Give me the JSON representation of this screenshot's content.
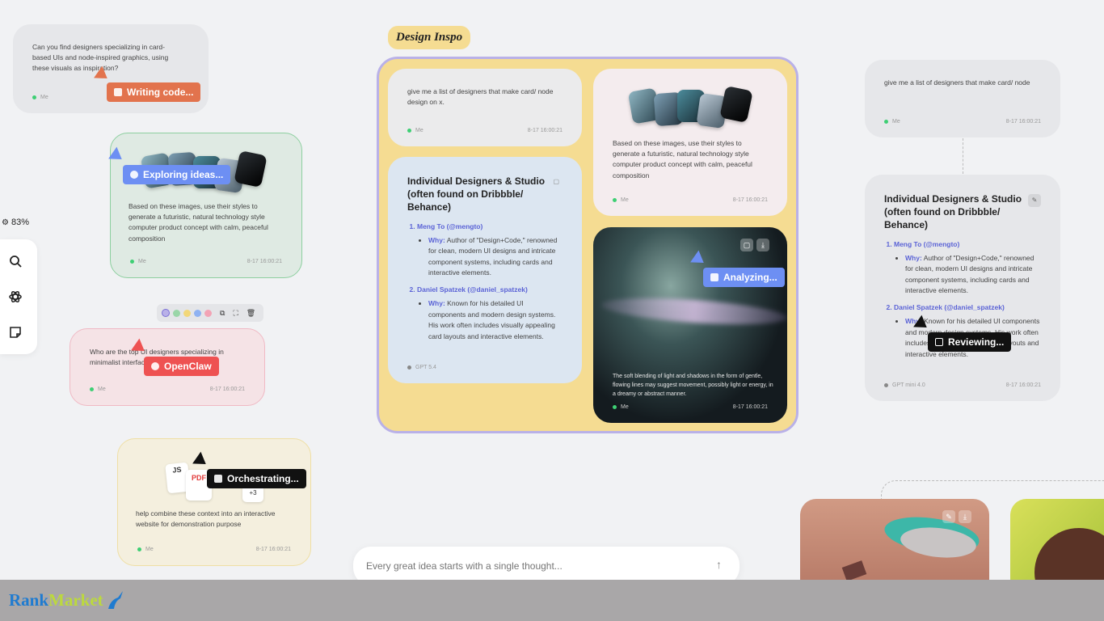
{
  "zoom": "83%",
  "cards": {
    "c1": {
      "text": "Can you find designers specializing in card-based UIs and node-inspired graphics, using these visuals as inspiration?",
      "who": "Me"
    },
    "c2": {
      "text": "Based on these images, use their styles to generate a futuristic, natural technology style computer product concept with calm, peaceful composition",
      "who": "Me",
      "time": "8-17 16:00:21"
    },
    "c3": {
      "text": "Who are the top UI designers specializing in minimalist interfaces?",
      "who": "Me",
      "time": "8-17 16:00:21"
    },
    "c4": {
      "text": "help combine these context into an interactive website for demonstration purpose",
      "who": "Me",
      "time": "8-17 16:00:21",
      "file_js": "JS",
      "file_pdf": "PDF",
      "more": "+3"
    },
    "g1": {
      "text": "give me a list of designers that make card/ node design on x.",
      "who": "Me",
      "time": "8-17 16:00:21"
    },
    "g2": {
      "text": "Based on these images, use their styles to generate a futuristic, natural technology style computer product concept with calm, peaceful composition",
      "who": "Me",
      "time": "8-17 16:00:21"
    },
    "g3": {
      "title": "Individual Designers & Studio (often found on Dribbble/ Behance)",
      "d1_name": "Meng To (@mengto)",
      "d1_why": "Why:",
      "d1_desc": "Author of \"Design+Code,\" renowned for clean, modern UI designs and intricate component systems, including cards and interactive elements.",
      "d2_name": "Daniel Spatzek (@daniel_spatzek)",
      "d2_why": "Why:",
      "d2_desc": "Known for his detailed UI components and modern design systems. His work often includes visually appealing card layouts and interactive elements.",
      "model": "GPT 5.4"
    },
    "g4": {
      "text": "The soft blending of light and shadows in the form of gentle, flowing lines may suggest movement, possibly light or energy, in a dreamy or abstract manner.",
      "who": "Me",
      "time": "8-17 16:00:21"
    },
    "r1": {
      "text": "give me a list of designers that make card/ node",
      "who": "Me",
      "time": "8-17 16:00:21"
    },
    "r2": {
      "title": "Individual Designers & Studio (often found on Dribbble/ Behance)",
      "d1_name": "Meng To (@mengto)",
      "d1_why": "Why:",
      "d1_desc": "Author of \"Design+Code,\" renowned for clean, modern UI designs and intricate component systems, including cards and interactive elements.",
      "d2_name": "Daniel Spatzek (@daniel_spatzek)",
      "d2_why": "Why:",
      "d2_desc": "Known for his detailed UI components and modern design systems. His work often includes visually appealing card layouts and interactive elements.",
      "model": "GPT mini 4.0",
      "time": "8-17 16:00:21"
    }
  },
  "group": {
    "title": "Design Inspo"
  },
  "agents": {
    "writing": "Writing code...",
    "exploring": "Exploring ideas...",
    "openclaw": "OpenClaw",
    "orchestrating": "Orchestrating...",
    "analyzing": "Analyzing...",
    "reviewing": "Reviewing..."
  },
  "composer": {
    "placeholder": "Every great idea starts with a single thought..."
  },
  "footer": {
    "brand_rank": "Rank",
    "brand_market": "Market"
  },
  "colors": {
    "orange": "#e2734d",
    "blue": "#6d8ff3",
    "red": "#ee5252",
    "black": "#111111",
    "group_bg": "#f5dc92",
    "group_border": "#b9b1e8"
  }
}
